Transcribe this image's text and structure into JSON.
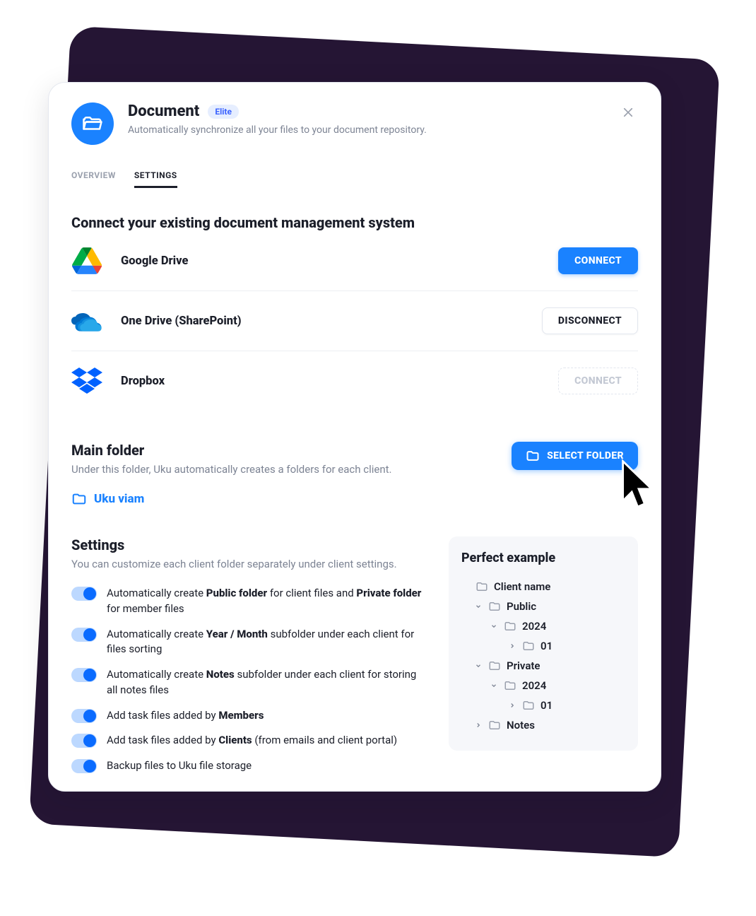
{
  "header": {
    "title": "Document",
    "badge": "Elite",
    "subtitle": "Automatically synchronize all your files to your document repository."
  },
  "tabs": {
    "overview": "OVERVIEW",
    "settings": "SETTINGS"
  },
  "connect": {
    "heading": "Connect your existing document management system",
    "providers": [
      {
        "name": "Google Drive",
        "action": "CONNECT",
        "style": "primary"
      },
      {
        "name": "One Drive (SharePoint)",
        "action": "DISCONNECT",
        "style": "outline"
      },
      {
        "name": "Dropbox",
        "action": "CONNECT",
        "style": "disabled"
      }
    ]
  },
  "main_folder": {
    "heading": "Main folder",
    "desc": "Under this folder, Uku automatically creates a folders for each client.",
    "current": "Uku viam",
    "button": "SELECT FOLDER"
  },
  "settings": {
    "heading": "Settings",
    "desc": "You can customize each client folder separately under client settings.",
    "options": [
      {
        "pre1": "Automatically create ",
        "b1": "Public folder",
        "mid": " for client files and ",
        "b2": "Private folder",
        "post": " for member files"
      },
      {
        "pre1": "Automatically create ",
        "b1": "Year / Month",
        "mid": " subfolder under each client for files sorting",
        "b2": "",
        "post": ""
      },
      {
        "pre1": "Automatically create ",
        "b1": "Notes",
        "mid": " subfolder under each client for storing all notes files",
        "b2": "",
        "post": ""
      },
      {
        "pre1": "Add task files added by ",
        "b1": "Members",
        "mid": "",
        "b2": "",
        "post": ""
      },
      {
        "pre1": "Add task files added by ",
        "b1": "Clients",
        "mid": " (from emails and client portal)",
        "b2": "",
        "post": ""
      },
      {
        "pre1": "Backup files to Uku file storage",
        "b1": "",
        "mid": "",
        "b2": "",
        "post": ""
      }
    ]
  },
  "example": {
    "heading": "Perfect example",
    "tree": {
      "client": "Client name",
      "public": "Public",
      "year": "2024",
      "month": "01",
      "private": "Private",
      "notes": "Notes"
    }
  },
  "colors": {
    "accent": "#1a82ff",
    "text": "#1c1f2a",
    "muted": "#7d8494"
  }
}
